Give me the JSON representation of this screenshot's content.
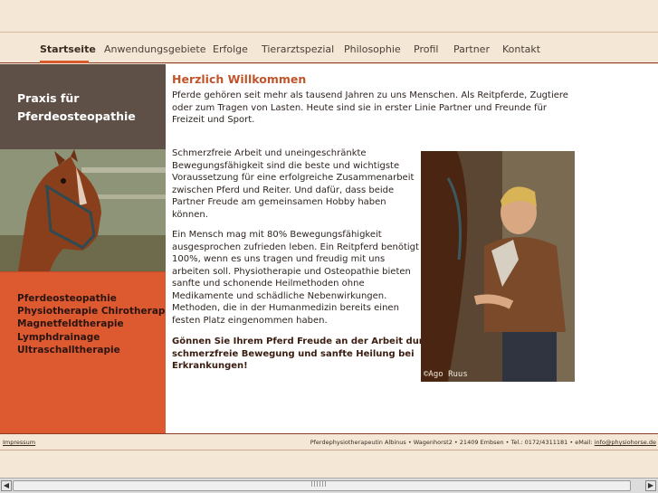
{
  "nav": {
    "items": [
      "Startseite",
      "Anwendungsgebiete",
      "Erfolge",
      "Tierarztspezial",
      "Philosophie",
      "Profil",
      "Partner",
      "Kontakt"
    ]
  },
  "sidebar": {
    "title_line1": "Praxis für",
    "title_line2": "Pferdeosteopathie",
    "image_name": "horse-photo",
    "services": [
      "Pferdeosteopathie",
      "Physiotherapie Chirotherapie",
      "Magnetfeldtherapie",
      "Lymphdrainage",
      "Ultraschalltherapie"
    ]
  },
  "main": {
    "heading": "Herzlich Willkommen",
    "intro_lines": [
      "Pferde gehören seit mehr als tausend Jahren zu uns Menschen. Als Reitpferde, Zugtiere",
      "oder zum Tragen von Lasten. Heute sind sie in erster Linie Partner und Freunde für",
      "Freizeit und Sport."
    ],
    "para1_lines": [
      "Schmerzfreie Arbeit und uneingeschränkte",
      "Bewegungsfähigkeit sind die beste und wichtigste",
      "Voraussetzung für eine erfolgreiche Zusammenarbeit",
      "zwischen Pferd und Reiter. Und dafür, dass beide",
      "Partner Freude am gemeinsamen Hobby haben",
      "können."
    ],
    "para2_lines": [
      "Ein Mensch mag mit 80% Bewegungsfähigkeit",
      "ausgesprochen zufrieden leben. Ein Reitpferd benötigt",
      "100%, wenn es uns tragen und freudig mit uns",
      "arbeiten soll. Physiotherapie und Osteopathie bieten",
      "sanfte und schonende Heilmethoden ohne",
      "Medikamente und schädliche Nebenwirkungen.",
      "Methoden, die in der Humanmedizin bereits einen",
      "festen Platz eingenommen haben."
    ],
    "para3_lines": [
      "Gönnen Sie Ihrem Pferd Freude an der Arbeit durch",
      "schmerzfreie Bewegung und sanfte Heilung bei",
      "Erkrankungen!"
    ],
    "photo_credit": "©Ago Ruus"
  },
  "footer": {
    "impressum": "Impressum",
    "contact_text": "Pferdephysiotherapeutin Albinus • Wagenhorst2 • 21409 Embsen • Tel.: 0172/4311181 • eMail: ",
    "email": "info@physiohorse.de"
  },
  "colors": {
    "accent": "#d95a2b",
    "heading": "#c0552b",
    "background": "#f5e7d6",
    "sidebar_dark": "#5f5047",
    "sidebar_orange": "#dd5a31"
  }
}
